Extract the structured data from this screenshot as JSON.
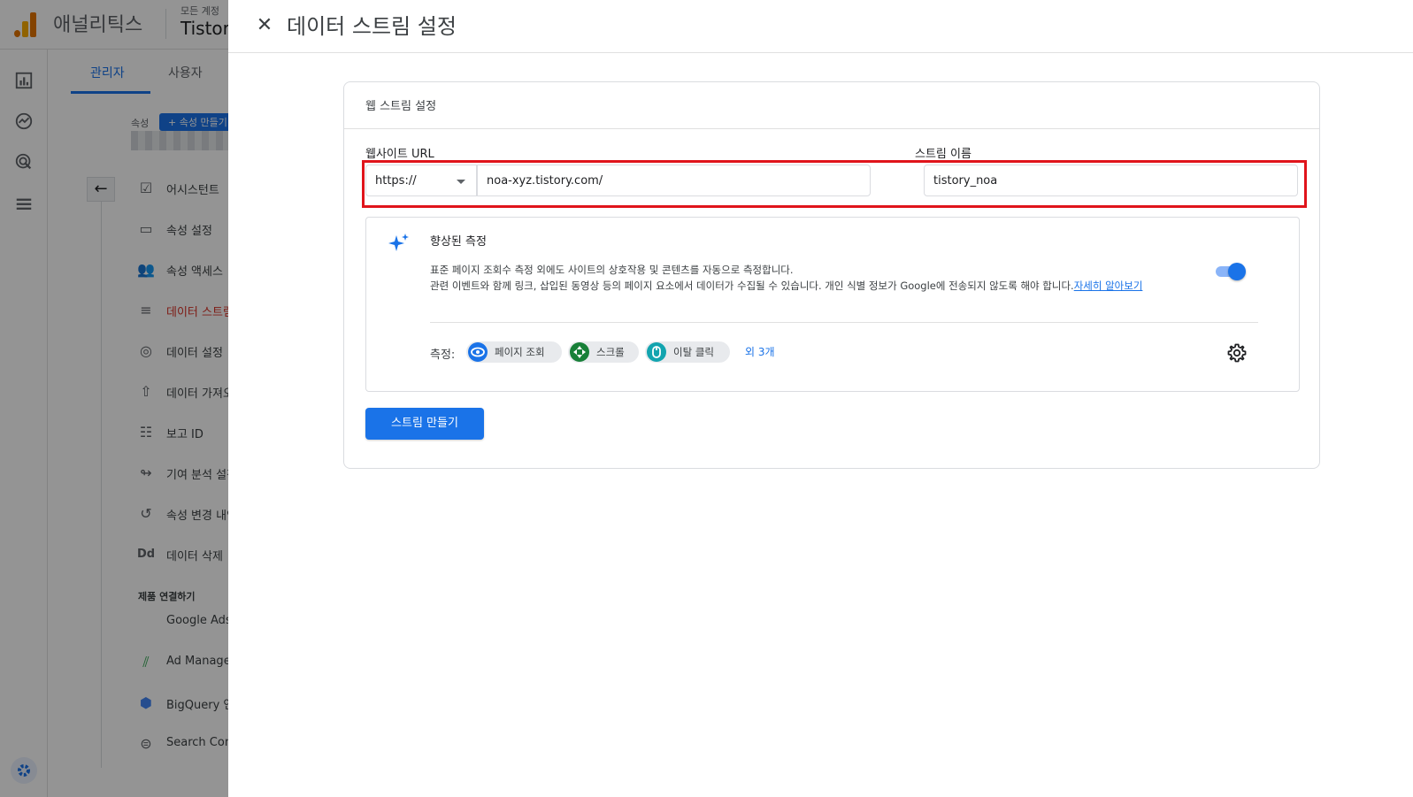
{
  "app": {
    "name": "애널리틱스",
    "account_top": "모든 계정",
    "account_name": "Tistory"
  },
  "admin": {
    "tabs": [
      {
        "label": "관리자",
        "active": true
      },
      {
        "label": "사용자",
        "active": false
      }
    ],
    "property_label": "속성",
    "create_property": "+ 속성 만들기",
    "menu": [
      {
        "label": "어시스턴트",
        "icon": "checklist-icon"
      },
      {
        "label": "속성 설정",
        "icon": "settings-window-icon"
      },
      {
        "label": "속성 액세스",
        "icon": "people-icon"
      },
      {
        "label": "데이터 스트림",
        "icon": "streams-icon",
        "active": true
      },
      {
        "label": "데이터 설정",
        "icon": "database-icon"
      },
      {
        "label": "데이터 가져오기",
        "icon": "upload-icon"
      },
      {
        "label": "보고 ID",
        "icon": "report-id-icon"
      },
      {
        "label": "기여 분석 설정",
        "icon": "attribution-icon"
      },
      {
        "label": "속성 변경 내역",
        "icon": "history-icon"
      },
      {
        "label": "데이터 삭제",
        "icon": "dd-icon"
      }
    ],
    "section_label": "제품 연결하기",
    "links": [
      {
        "label": "Google Ads",
        "icon": ""
      },
      {
        "label": "Ad Manager",
        "icon": "ad-manager-icon"
      },
      {
        "label": "BigQuery 연결",
        "icon": "bigquery-icon"
      },
      {
        "label": "Search Console",
        "icon": "search-console-icon"
      }
    ]
  },
  "dialog": {
    "title": "데이터 스트림 설정",
    "card_title": "웹 스트림 설정",
    "website_url_label": "웹사이트 URL",
    "protocol": "https://",
    "url_value": "noa-xyz.tistory.com/",
    "stream_name_label": "스트림 이름",
    "stream_name_value": "tistory_noa",
    "enhanced": {
      "title": "향상된 측정",
      "desc_line1": "표준 페이지 조회수 측정 외에도 사이트의 상호작용 및 콘텐츠를 자동으로 측정합니다.",
      "desc_line2": "관련 이벤트와 함께 링크, 삽입된 동영상 등의 페이지 요소에서 데이터가 수집될 수 있습니다. 개인 식별 정보가 Google에 전송되지 않도록 해야 합니다.",
      "learn_more": "자세히 알아보기",
      "enabled": true,
      "measure_label": "측정:",
      "chips": [
        {
          "label": "페이지 조회",
          "icon": "eye-icon",
          "color": "#1a73e8"
        },
        {
          "label": "스크롤",
          "icon": "scroll-icon",
          "color": "#188038"
        },
        {
          "label": "이탈 클릭",
          "icon": "mouse-icon",
          "color": "#12a4af"
        }
      ],
      "more": "외 3개"
    },
    "create_button": "스트림 만들기"
  },
  "colors": {
    "accent": "#1a73e8",
    "highlight_box": "#e0141b"
  }
}
